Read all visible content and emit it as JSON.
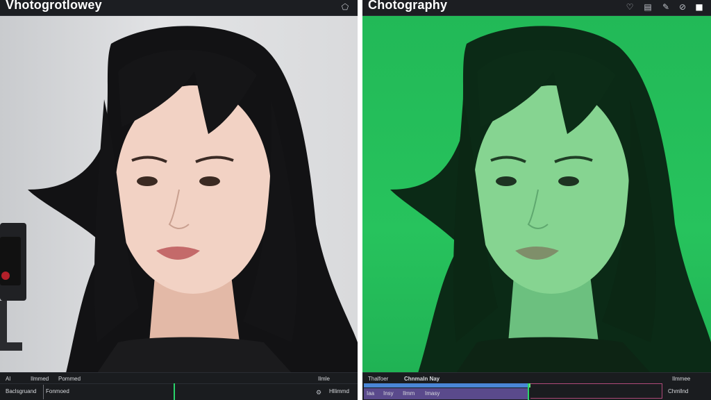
{
  "left_panel": {
    "title": "Vhotogrotlowey",
    "tab_a": "Al",
    "tab_b": "Ilmmed",
    "tab_c": "Pommed",
    "track_label": "Baclsgruand",
    "track_value": "Fonmoed",
    "right_a": "Ilmle",
    "right_b": "Ilmle",
    "right_c": "Hllimmd",
    "icons": [
      "tag-icon",
      "settings-icon"
    ]
  },
  "right_panel": {
    "title": "Chotography",
    "tab_a": "Thalfoer",
    "tab_b": "Chnmaln Nay",
    "right_a": "Ilmmee",
    "right_b": "Chmllnd",
    "clip_labels": [
      "Iaa",
      "Insy",
      "Ilmm",
      "Imasy"
    ],
    "icons": [
      "heart-icon",
      "layers-icon",
      "brush-icon",
      "help-icon",
      "square-icon"
    ]
  },
  "colors": {
    "left_background": "#d9dadc",
    "green_screen": "#27c35d",
    "playhead": "#29d46a",
    "clip_blue": "#4a86d6",
    "clip_purple": "#5a4a8c"
  }
}
